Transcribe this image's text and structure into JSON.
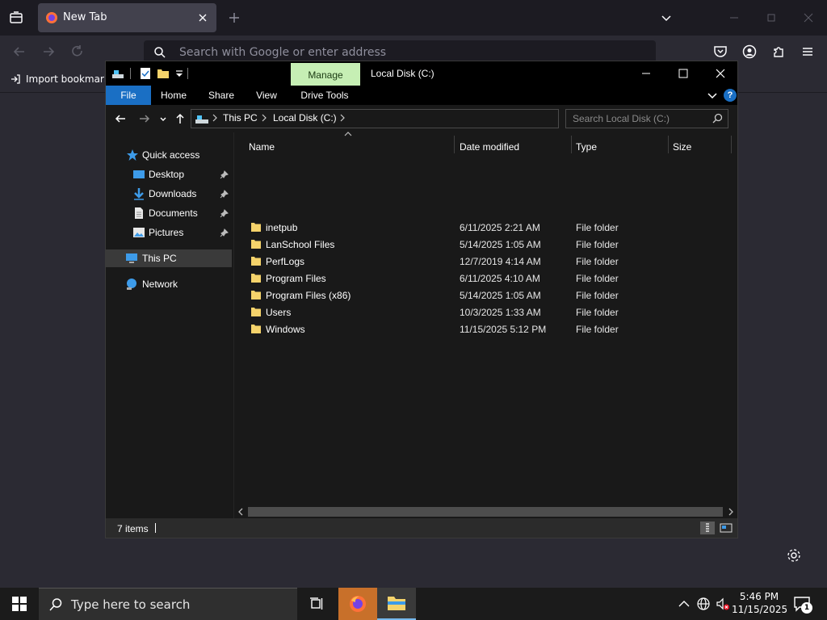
{
  "browser": {
    "tab": {
      "title": "New Tab"
    },
    "urlbar": {
      "placeholder": "Search with Google or enter address"
    },
    "bookmarks": {
      "import_label": "Import bookmarks..."
    }
  },
  "explorer": {
    "title": "Local Disk (C:)",
    "contextual_tab_group": "Manage",
    "ribbon_tabs": [
      "File",
      "Home",
      "Share",
      "View",
      "Drive Tools"
    ],
    "help_label": "?",
    "breadcrumb": [
      "This PC",
      "Local Disk (C:)"
    ],
    "search_placeholder": "Search Local Disk (C:)",
    "nav": {
      "quick_access": "Quick access",
      "desktop": "Desktop",
      "downloads": "Downloads",
      "documents": "Documents",
      "pictures": "Pictures",
      "this_pc": "This PC",
      "network": "Network"
    },
    "columns": {
      "name": "Name",
      "date": "Date modified",
      "type": "Type",
      "size": "Size"
    },
    "files": [
      {
        "name": "inetpub",
        "date": "6/11/2025 2:21 AM",
        "type": "File folder",
        "size": ""
      },
      {
        "name": "LanSchool Files",
        "date": "5/14/2025 1:05 AM",
        "type": "File folder",
        "size": ""
      },
      {
        "name": "PerfLogs",
        "date": "12/7/2019 4:14 AM",
        "type": "File folder",
        "size": ""
      },
      {
        "name": "Program Files",
        "date": "6/11/2025 4:10 AM",
        "type": "File folder",
        "size": ""
      },
      {
        "name": "Program Files (x86)",
        "date": "5/14/2025 1:05 AM",
        "type": "File folder",
        "size": ""
      },
      {
        "name": "Users",
        "date": "10/3/2025 1:33 AM",
        "type": "File folder",
        "size": ""
      },
      {
        "name": "Windows",
        "date": "11/15/2025 5:12 PM",
        "type": "File folder",
        "size": ""
      }
    ],
    "status": {
      "item_count": "7 items"
    }
  },
  "taskbar": {
    "search_placeholder": "Type here to search",
    "time": "5:46 PM",
    "date": "11/15/2025",
    "notification_count": "1"
  },
  "colors": {
    "accent": "#1a6fc4",
    "manage_tab": "#c6efb4",
    "folder": "#f5d36b"
  }
}
